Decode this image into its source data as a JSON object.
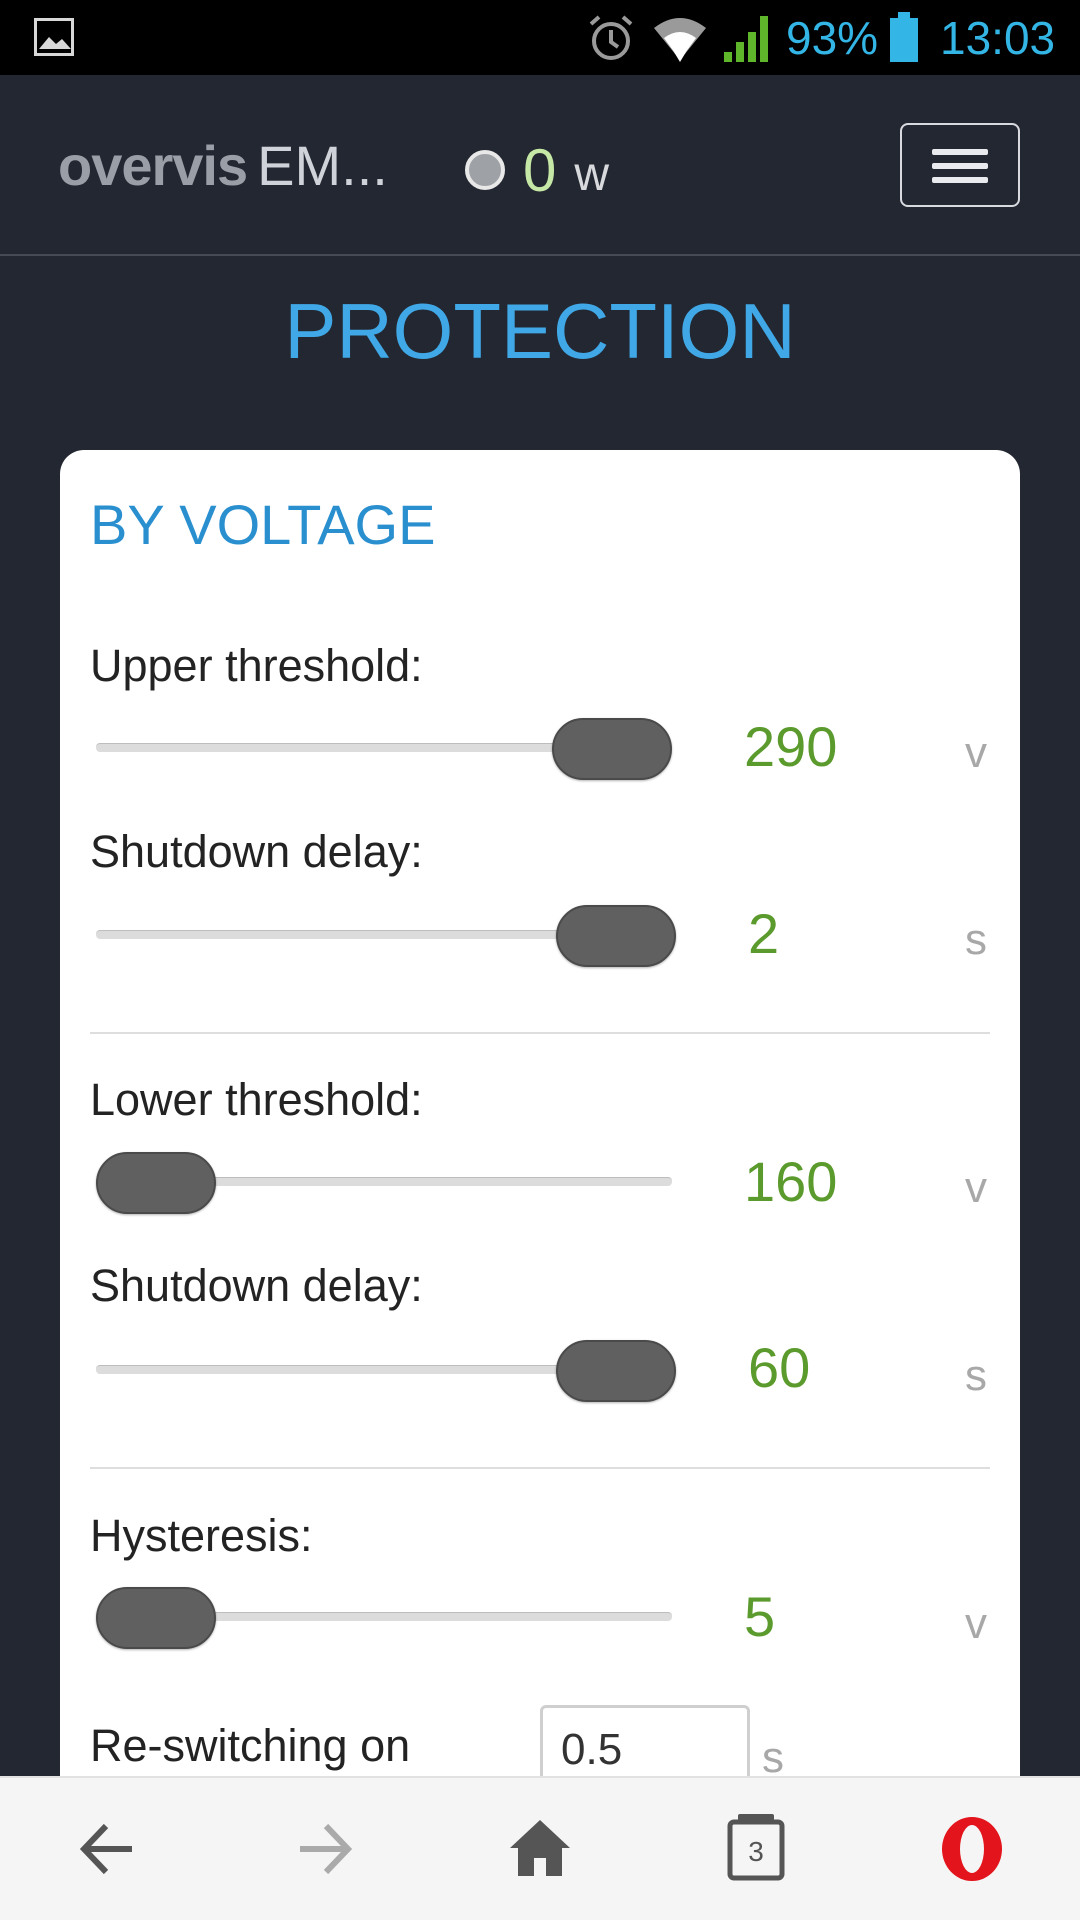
{
  "status_bar": {
    "battery_percent": "93%",
    "clock": "13:03",
    "icons": [
      "gallery-icon",
      "alarm-icon",
      "wifi-icon",
      "signal-icon",
      "battery-icon"
    ]
  },
  "header": {
    "brand_logo": "overvis",
    "brand_model": "EM...",
    "power_value": "0",
    "power_unit": "w",
    "menu_icon": "hamburger-menu-icon"
  },
  "page": {
    "title": "PROTECTION"
  },
  "card": {
    "title": "BY VOLTAGE",
    "upper_threshold": {
      "label": "Upper threshold:",
      "value": "290",
      "unit": "v",
      "level": 1.0
    },
    "upper_delay": {
      "label": "Shutdown delay:",
      "value": "2",
      "unit": "s",
      "level": 1.0
    },
    "lower_threshold": {
      "label": "Lower threshold:",
      "value": "160",
      "unit": "v",
      "level": 0.0
    },
    "lower_delay": {
      "label": "Shutdown delay:",
      "value": "60",
      "unit": "s",
      "level": 1.0
    },
    "hysteresis": {
      "label": "Hysteresis:",
      "value": "5",
      "unit": "v",
      "level": 0.0
    },
    "reswitching": {
      "label": "Re-switching on",
      "value": "0.5",
      "unit": "s"
    }
  },
  "bottom_nav": {
    "tabs_count": "3",
    "icons": [
      "back-arrow-icon",
      "forward-arrow-icon",
      "home-icon",
      "tabs-icon",
      "opera-logo-icon"
    ]
  },
  "colors": {
    "accent_blue": "#40a8e6",
    "value_green": "#5b9a2c",
    "header_bg": "#232731",
    "opera_red": "#e3141b"
  }
}
